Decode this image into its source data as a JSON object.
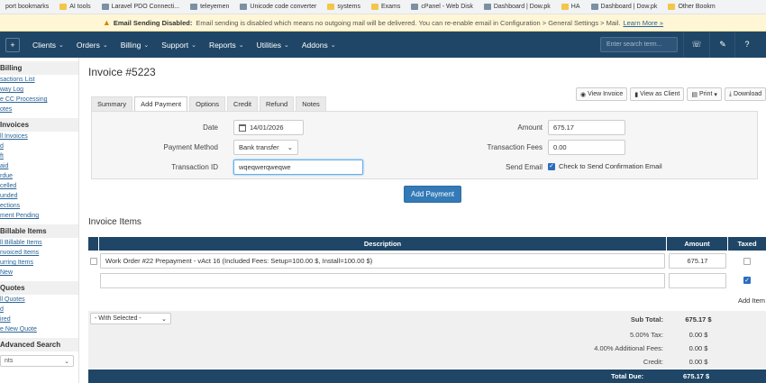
{
  "bookmarks": [
    "port bookmarks",
    "AI tools",
    "Laravel PDO Connecti...",
    "teleyemen",
    "Unicode code converter",
    "systems",
    "Exams",
    "cPanel - Web Disk",
    "Dashboard | Dow.pk",
    "HA",
    "Dashboard | Dow.pk",
    "Other Bookm"
  ],
  "banner": {
    "title": "Email Sending Disabled:",
    "text": "Email sending is disabled which means no outgoing mail will be delivered. You can re-enable email in Configuration > General Settings > Mail.",
    "link": "Learn More »"
  },
  "nav": {
    "items": [
      "Clients",
      "Orders",
      "Billing",
      "Support",
      "Reports",
      "Utilities",
      "Addons"
    ],
    "search_placeholder": "Enter search term..."
  },
  "sidebar": {
    "billing_head": "Billing",
    "billing_items": [
      "sactions List",
      "way Log",
      "e CC Processing",
      "otes"
    ],
    "invoices_head": "Invoices",
    "invoice_items": [
      "ll Invoices",
      "d",
      "ft",
      "aid",
      "rdue",
      "celled",
      "unded",
      "ections",
      "ment Pending"
    ],
    "billable_head": "Billable Items",
    "billable_items": [
      "ll Billable Items",
      "nvoiced Items",
      "urring Items",
      "New"
    ],
    "quotes_head": "Quotes",
    "quote_items": [
      "ll Quotes",
      "d",
      "ired",
      "e New Quote"
    ],
    "advanced_head": "Advanced Search",
    "advanced_select": "nts"
  },
  "page": {
    "title": "Invoice #5223",
    "actions": [
      "View Invoice",
      "View as Client",
      "Print",
      "Download"
    ]
  },
  "tabs": [
    "Summary",
    "Add Payment",
    "Options",
    "Credit",
    "Refund",
    "Notes"
  ],
  "payment_form": {
    "date_label": "Date",
    "date_value": "14/01/2026",
    "method_label": "Payment Method",
    "method_value": "Bank transfer",
    "txn_label": "Transaction ID",
    "txn_value": "wqeqwerqweqwe",
    "amount_label": "Amount",
    "amount_value": "675.17",
    "fees_label": "Transaction Fees",
    "fees_value": "0.00",
    "send_label": "Send Email",
    "send_text": "Check to Send Confirmation Email",
    "submit": "Add Payment"
  },
  "items": {
    "title": "Invoice Items",
    "headers": [
      "Description",
      "Amount",
      "Taxed"
    ],
    "rows": [
      {
        "description": "Work Order #22 Prepayment - vAct 16 (Included Fees: Setup=100.00 $, Install=100.00 $)",
        "amount": "675.17"
      }
    ],
    "add_item": "Add Item"
  },
  "totals": {
    "with_selected": "- With Selected -",
    "subtotal_label": "Sub Total:",
    "subtotal_value": "675.17 $",
    "tax_label": "5.00% Tax:",
    "tax_value": "0.00 $",
    "fees_label": "4.00% Additional Fees:",
    "fees_value": "0.00 $",
    "credit_label": "Credit:",
    "credit_value": "0.00 $",
    "total_label": "Total Due:",
    "total_value": "675.17 $"
  }
}
